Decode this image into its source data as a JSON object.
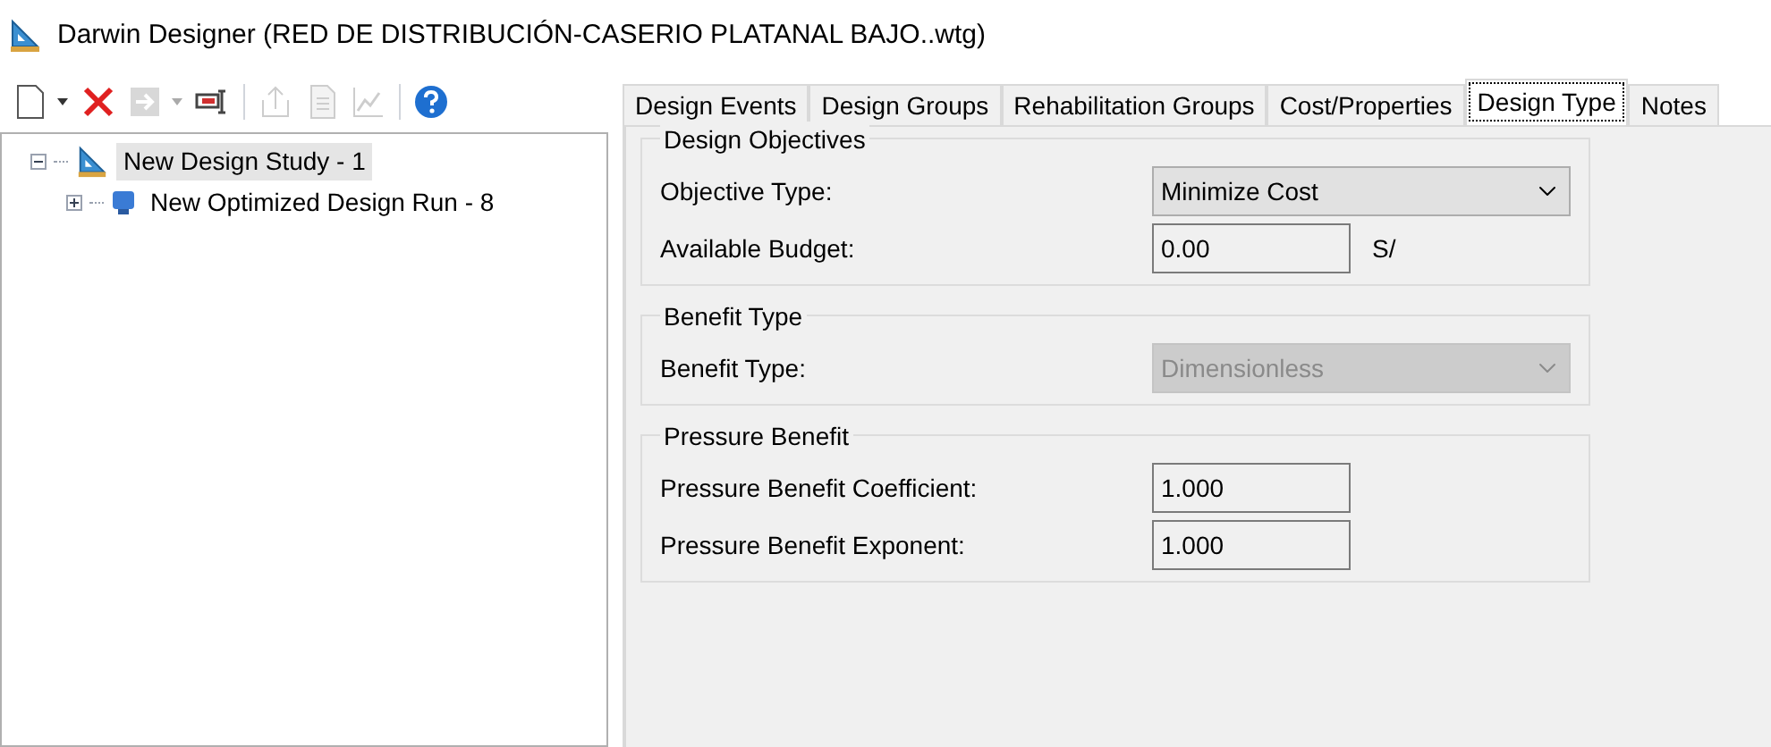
{
  "window": {
    "title": "Darwin Designer (RED DE DISTRIBUCIÓN-CASERIO PLATANAL BAJO..wtg)"
  },
  "toolbar": [
    {
      "kind": "new",
      "disabled": false,
      "dropdown": true
    },
    {
      "kind": "delete",
      "disabled": false,
      "dropdown": false
    },
    {
      "kind": "run",
      "disabled": true,
      "dropdown": true
    },
    {
      "kind": "rename",
      "disabled": false,
      "dropdown": false
    },
    {
      "kind": "separator"
    },
    {
      "kind": "export",
      "disabled": true,
      "dropdown": false
    },
    {
      "kind": "report",
      "disabled": true,
      "dropdown": false
    },
    {
      "kind": "graph",
      "disabled": true,
      "dropdown": false
    },
    {
      "kind": "separator"
    },
    {
      "kind": "help",
      "disabled": false,
      "dropdown": false
    }
  ],
  "tree": [
    {
      "label": "New Design Study - 1",
      "kind": "study",
      "expanded": true,
      "selected": true,
      "children": [
        {
          "label": "New Optimized Design Run - 8",
          "kind": "run",
          "expanded": false,
          "selected": false
        }
      ]
    }
  ],
  "tabs": [
    {
      "label": "Design Events",
      "selected": false
    },
    {
      "label": "Design Groups",
      "selected": false
    },
    {
      "label": "Rehabilitation Groups",
      "selected": false
    },
    {
      "label": "Cost/Properties",
      "selected": false
    },
    {
      "label": "Design Type",
      "selected": true
    },
    {
      "label": "Notes",
      "selected": false
    }
  ],
  "groups": [
    {
      "title": "Design Objectives",
      "fields": [
        {
          "kind": "dropdown",
          "label": "Objective Type:",
          "value": "Minimize Cost",
          "disabled": false
        },
        {
          "kind": "text",
          "label": "Available Budget:",
          "value": "0.00",
          "unit": "S/"
        }
      ]
    },
    {
      "title": "Benefit Type",
      "fields": [
        {
          "kind": "dropdown",
          "label": "Benefit Type:",
          "value": "Dimensionless",
          "disabled": true
        }
      ]
    },
    {
      "title": "Pressure Benefit",
      "fields": [
        {
          "kind": "text",
          "label": "Pressure Benefit Coefficient:",
          "value": "1.000"
        },
        {
          "kind": "text",
          "label": "Pressure Benefit Exponent:",
          "value": "1.000"
        }
      ]
    }
  ]
}
